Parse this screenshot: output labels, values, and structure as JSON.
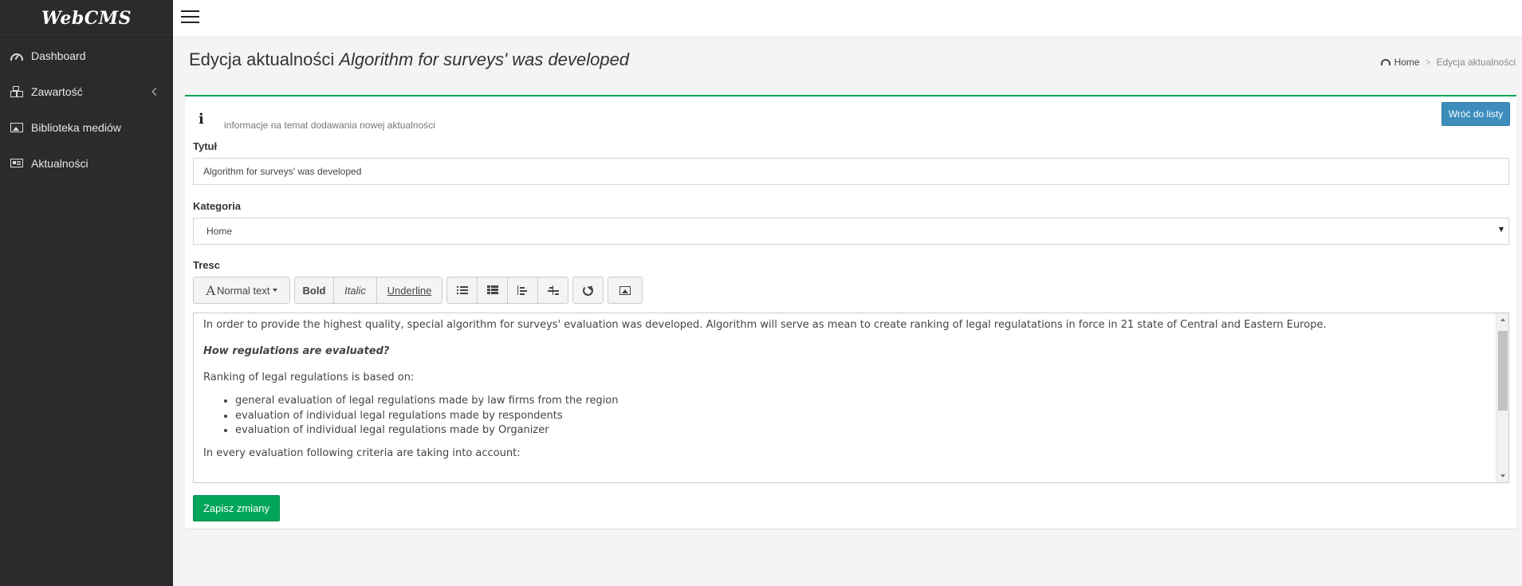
{
  "app": {
    "brand": "WebCMS"
  },
  "sidebar": {
    "items": [
      {
        "label": "Dashboard",
        "icon": "dashboard-icon"
      },
      {
        "label": "Zawartość",
        "icon": "cubes-icon"
      },
      {
        "label": "Biblioteka mediów",
        "icon": "image-icon"
      },
      {
        "label": "Aktualności",
        "icon": "newspaper-icon"
      }
    ]
  },
  "header": {
    "title_prefix": "Edycja aktualności",
    "title_subject": "Algorithm for surveys' was developed",
    "breadcrumb": {
      "home": "Home",
      "separator": ">",
      "current": "Edycja aktualności"
    }
  },
  "form": {
    "back_button": "Wróć do listy",
    "info_text": "informacje na temat dodawania nowej aktualności",
    "title_label": "Tytuł",
    "title_value": "Algorithm for surveys' was developed",
    "category_label": "Kategoria",
    "category_value": "Home",
    "content_label": "Tresc",
    "save_button": "Zapisz zmiany"
  },
  "toolbar": {
    "text_style": "Normal text",
    "bold": "Bold",
    "italic": "Italic",
    "underline": "Underline"
  },
  "editor": {
    "p1": "In order to provide the highest quality, special algorithm for surveys' evaluation was developed. Algorithm will serve as mean to create ranking of legal regulatations in force in 21 state of Central and Eastern Europe.",
    "question": "How regulations are evaluated?",
    "p2": "Ranking of legal regulations is based on:",
    "list": [
      "general evaluation of legal regulations made by law firms from the region",
      "evaluation of individual legal regulations made by respondents",
      "evaluation of individual legal regulations made by Organizer"
    ],
    "p3": "In every evaluation following criteria are taking into account:"
  },
  "colors": {
    "sidebar_bg": "#2b2b2b",
    "primary": "#3c8dbc",
    "success": "#00a65a"
  }
}
